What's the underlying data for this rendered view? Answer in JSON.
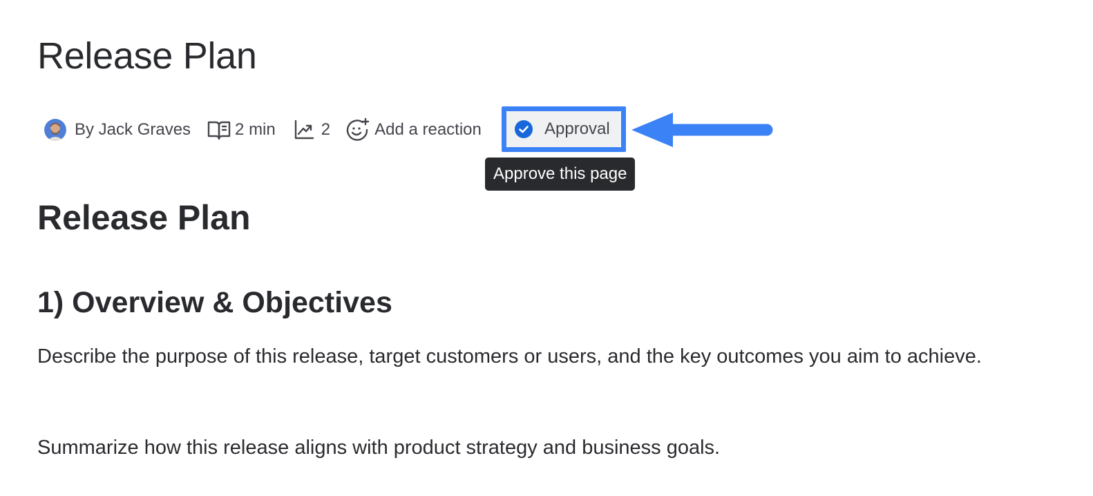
{
  "page": {
    "title": "Release Plan"
  },
  "byline": {
    "author": "By Jack Graves",
    "read_time": "2 min",
    "views": "2",
    "reaction_label": "Add a reaction",
    "approval_label": "Approval"
  },
  "tooltip": {
    "text": "Approve this page"
  },
  "content": {
    "heading": "Release Plan",
    "section_heading": "1) Overview & Objectives",
    "paragraph_1": "Describe the purpose of this release, target customers or users, and the key outcomes you aim to achieve.",
    "paragraph_2": "Summarize how this release aligns with product strategy and business goals."
  },
  "icons": {
    "read_time": "book-open-icon",
    "views": "trend-up-icon",
    "reaction": "emoji-add-icon",
    "approval": "check-circle-icon",
    "annotation": "arrow-left-icon"
  },
  "colors": {
    "highlight": "#3b82f6",
    "approval_check": "#1868db",
    "tooltip_bg": "#292a2e",
    "text": "#292a2e"
  }
}
